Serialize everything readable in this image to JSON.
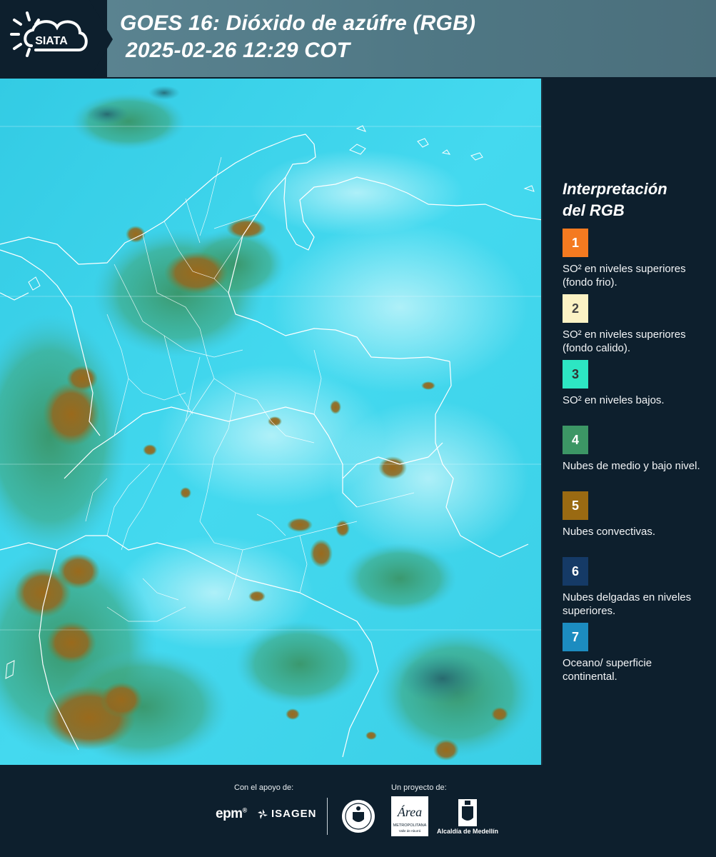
{
  "header": {
    "logo_text": "SIATA",
    "title_line1": "GOES 16: Dióxido de azúfre (RGB)",
    "title_line2": "2025-02-26 12:29 COT"
  },
  "legend": {
    "title_line1": "Interpretación",
    "title_line2": "del RGB",
    "items": [
      {
        "number": "1",
        "color": "#f47a20",
        "text_color": "#ffffff",
        "label": "SO² en niveles superiores (fondo frio)."
      },
      {
        "number": "2",
        "color": "#fbf2c4",
        "text_color": "#444444",
        "label": "SO² en niveles superiores (fondo calido)."
      },
      {
        "number": "3",
        "color": "#2de6c3",
        "text_color": "#333333",
        "label": "SO² en niveles bajos."
      },
      {
        "number": "4",
        "color": "#3c9665",
        "text_color": "#ffffff",
        "label": "Nubes de medio y bajo nivel."
      },
      {
        "number": "5",
        "color": "#9a6a12",
        "text_color": "#ffffff",
        "label": "Nubes convectivas."
      },
      {
        "number": "6",
        "color": "#153a66",
        "text_color": "#ffffff",
        "label": "Nubes delgadas en niveles superiores."
      },
      {
        "number": "7",
        "color": "#1c8cc0",
        "text_color": "#ffffff",
        "label": "Oceano/ superficie continental."
      }
    ]
  },
  "footer": {
    "support_label": "Con el apoyo de:",
    "project_label": "Un proyecto de:",
    "sponsor1": "epm",
    "sponsor2": "ISAGEN",
    "area_script": "Área",
    "area_caption": "METROPOLITANA",
    "area_subcaption": "Valle de Aburrá",
    "alcaldia": "Alcaldía de Medellín"
  },
  "colors": {
    "background": "#0d1f2d",
    "header_band": "#527b88",
    "map_cyan": "#3fd6ee",
    "map_green": "#3b9a6a",
    "map_brown": "#9a6b1e"
  }
}
